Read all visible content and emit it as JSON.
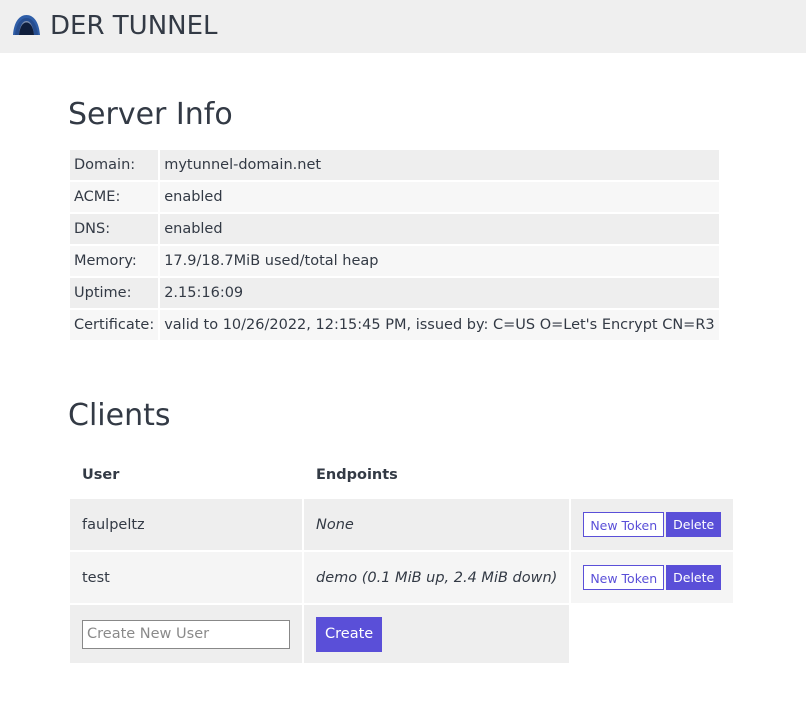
{
  "header": {
    "brand": "DER TUNNEL",
    "logo_icon": "tunnel-arch-icon",
    "logo_color": "#3b5fa3"
  },
  "server_info": {
    "title": "Server Info",
    "rows": [
      {
        "key": "Domain:",
        "value": "mytunnel-domain.net"
      },
      {
        "key": "ACME:",
        "value": "enabled"
      },
      {
        "key": "DNS:",
        "value": "enabled"
      },
      {
        "key": "Memory:",
        "value": "17.9/18.7MiB used/total heap"
      },
      {
        "key": "Uptime:",
        "value": "2.15:16:09"
      },
      {
        "key": "Certificate:",
        "value": "valid to 10/26/2022, 12:15:45 PM, issued by: C=US O=Let's Encrypt CN=R3"
      }
    ]
  },
  "clients": {
    "title": "Clients",
    "columns": {
      "user": "User",
      "endpoints": "Endpoints"
    },
    "rows": [
      {
        "user": "faulpeltz",
        "endpoints": "None",
        "new_token_label": "New Token",
        "delete_label": "Delete"
      },
      {
        "user": "test",
        "endpoints": "demo (0.1 MiB up, 2.4 MiB down)",
        "new_token_label": "New Token",
        "delete_label": "Delete"
      }
    ],
    "new_user": {
      "placeholder": "Create New User",
      "value": "",
      "create_label": "Create"
    }
  },
  "colors": {
    "accent": "#5a4fd8",
    "header_bg": "#efefef",
    "text": "#333a45"
  }
}
